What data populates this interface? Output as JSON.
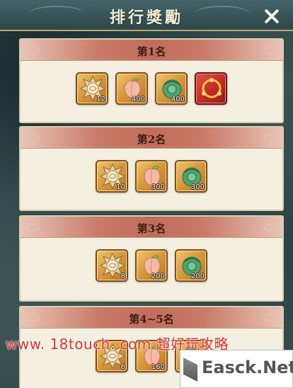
{
  "header": {
    "title": "排行獎勵"
  },
  "sections": [
    {
      "title": "第1名",
      "items": [
        {
          "icon": "sun-medal-icon",
          "count": "12"
        },
        {
          "icon": "peach-icon",
          "count": "400"
        },
        {
          "icon": "jade-token-icon",
          "count": "400"
        },
        {
          "icon": "golden-ring-icon",
          "count": ""
        }
      ]
    },
    {
      "title": "第2名",
      "items": [
        {
          "icon": "sun-medal-icon",
          "count": "10"
        },
        {
          "icon": "peach-icon",
          "count": "300"
        },
        {
          "icon": "jade-token-icon",
          "count": "300"
        }
      ]
    },
    {
      "title": "第3名",
      "items": [
        {
          "icon": "sun-medal-icon",
          "count": "8"
        },
        {
          "icon": "peach-icon",
          "count": "200"
        },
        {
          "icon": "jade-token-icon",
          "count": "200"
        }
      ]
    },
    {
      "title": "第4~5名",
      "items": [
        {
          "icon": "sun-medal-icon",
          "count": "6"
        },
        {
          "icon": "peach-icon",
          "count": "160"
        },
        {
          "icon": "jade-token-icon",
          "count": ""
        }
      ]
    }
  ],
  "watermark": {
    "text": "www. 18touch. com  超好玩攻略"
  },
  "badge": {
    "text": "Easck.Net"
  }
}
